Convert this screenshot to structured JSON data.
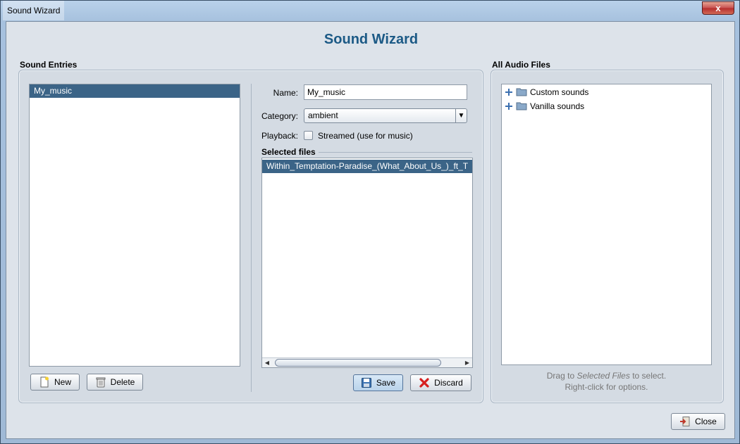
{
  "window": {
    "title": "Sound Wizard",
    "close_glyph": "x"
  },
  "heading": "Sound Wizard",
  "sound_entries": {
    "label": "Sound Entries",
    "items": [
      {
        "label": "My_music",
        "selected": true
      }
    ],
    "new_button": "New",
    "delete_button": "Delete"
  },
  "editor": {
    "name_label": "Name:",
    "name_value": "My_music",
    "category_label": "Category:",
    "category_value": "ambient",
    "playback_label": "Playback:",
    "streamed_label": "Streamed (use for music)",
    "streamed_checked": false,
    "selected_files_label": "Selected files",
    "selected_files": [
      {
        "label": "Within_Temptation-Paradise_(What_About_Us_)_ft_T",
        "selected": true
      }
    ],
    "save_button": "Save",
    "discard_button": "Discard"
  },
  "audio_files": {
    "label": "All Audio Files",
    "tree": [
      {
        "label": "Custom sounds",
        "icon": "folder-icon"
      },
      {
        "label": "Vanilla sounds",
        "icon": "folder-icon"
      }
    ],
    "hint_prefix": "Drag to",
    "hint_emphasis": "Selected Files",
    "hint_suffix": "to select.",
    "hint_line2": "Right-click for options."
  },
  "close_button": "Close",
  "colors": {
    "heading": "#1c5a86",
    "selection": "#3b6487",
    "discard_icon": "#d62020",
    "close_icon": "#c0392b"
  }
}
